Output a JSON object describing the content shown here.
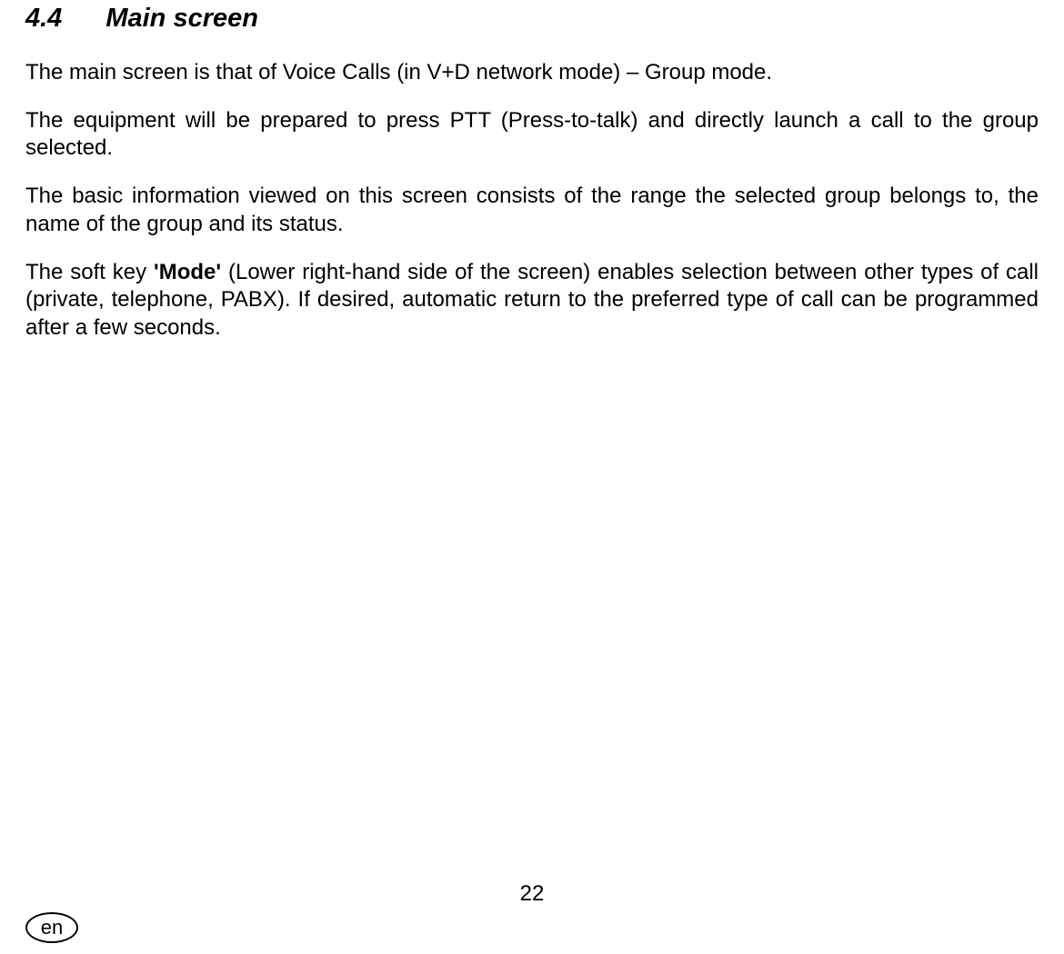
{
  "heading": {
    "number": "4.4",
    "title": "Main screen"
  },
  "paragraphs": {
    "p1": "The main screen is that of Voice Calls (in V+D network mode) – Group mode.",
    "p2": "The equipment will be prepared to press PTT (Press-to-talk) and directly launch a call to the group selected.",
    "p3": "The basic information viewed on this screen consists of the range the selected group belongs to, the name of the group and its status.",
    "p4a": "The soft key ",
    "p4b": "'Mode'",
    "p4c": " (Lower right-hand side of the screen) enables selection between other types of call (private, telephone, PABX). If desired, automatic return to the preferred type of call can be programmed after a few seconds."
  },
  "pageNumber": "22",
  "langBadge": "en"
}
